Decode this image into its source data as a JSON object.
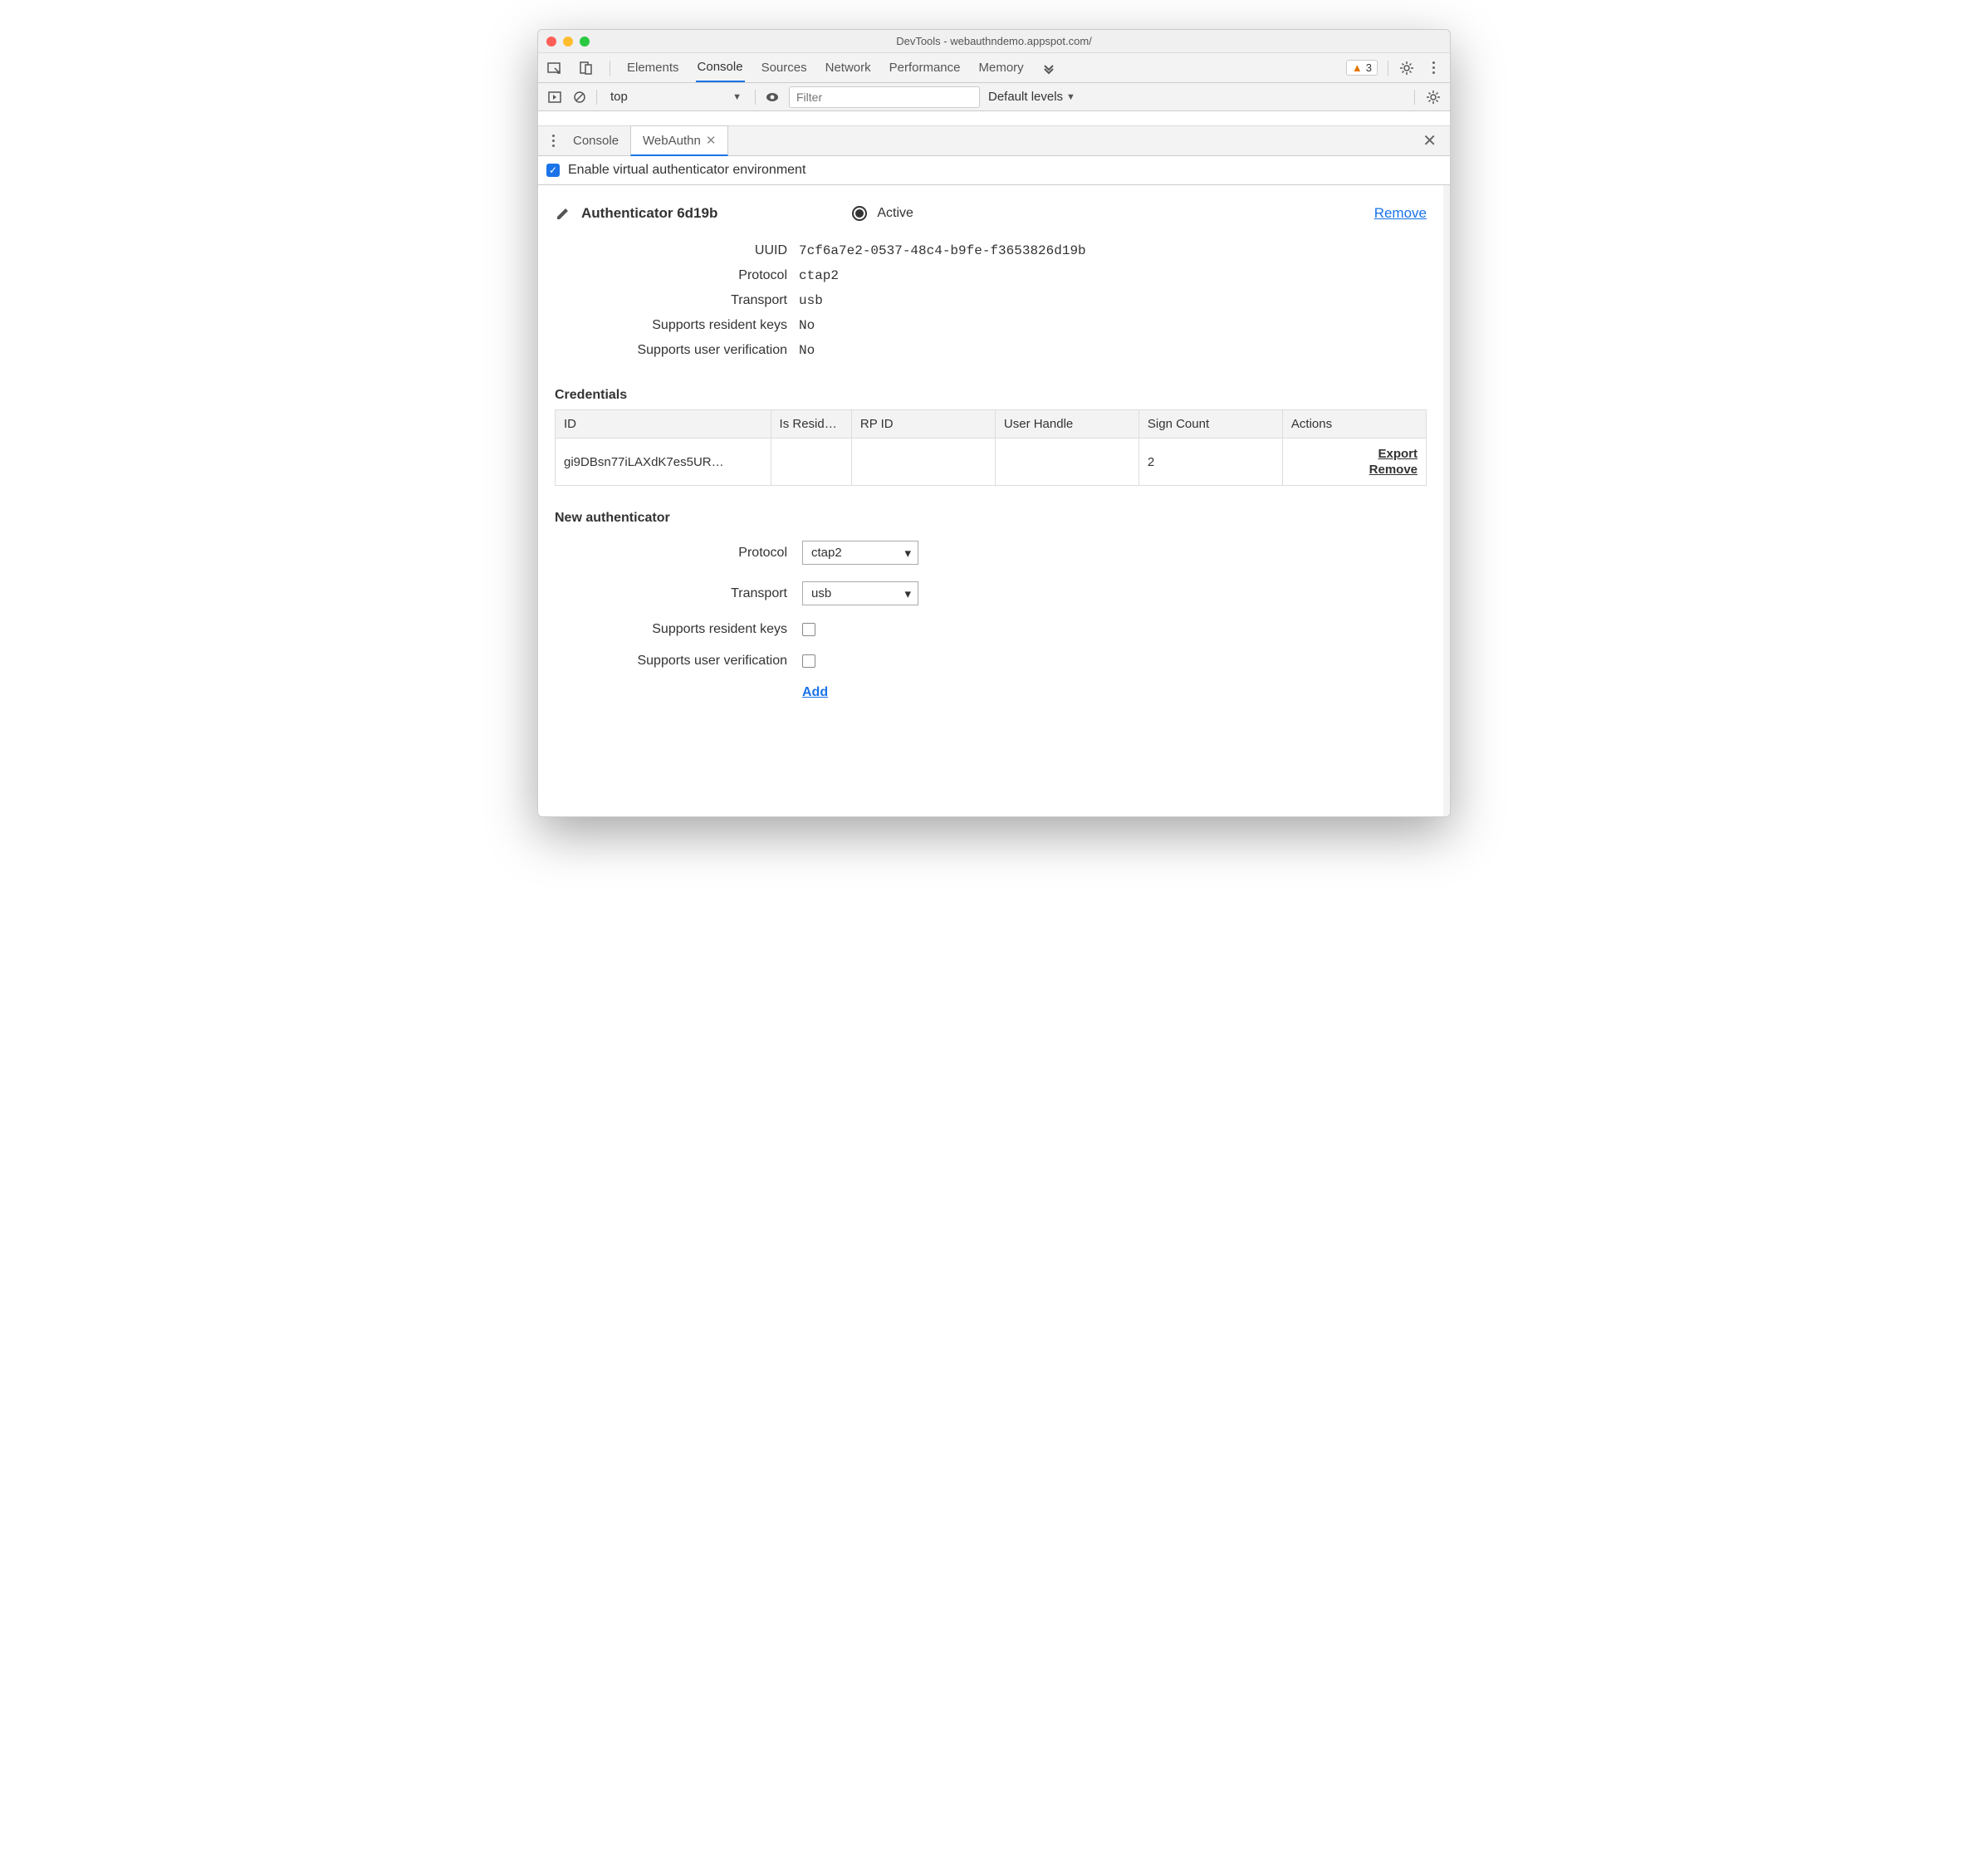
{
  "window": {
    "title": "DevTools - webauthndemo.appspot.com/"
  },
  "main_tabs": {
    "elements": "Elements",
    "console": "Console",
    "sources": "Sources",
    "network": "Network",
    "performance": "Performance",
    "memory": "Memory",
    "active": "Console"
  },
  "issues": {
    "count": "3"
  },
  "console_bar": {
    "context": "top",
    "filter_placeholder": "Filter",
    "levels": "Default levels"
  },
  "drawer_tabs": {
    "console": "Console",
    "webauthn": "WebAuthn",
    "active": "WebAuthn"
  },
  "enable_label": "Enable virtual authenticator environment",
  "authenticator": {
    "name": "Authenticator 6d19b",
    "active_label": "Active",
    "remove_label": "Remove",
    "props": {
      "uuid_label": "UUID",
      "uuid": "7cf6a7e2-0537-48c4-b9fe-f3653826d19b",
      "protocol_label": "Protocol",
      "protocol": "ctap2",
      "transport_label": "Transport",
      "transport": "usb",
      "rk_label": "Supports resident keys",
      "rk": "No",
      "uv_label": "Supports user verification",
      "uv": "No"
    }
  },
  "credentials": {
    "title": "Credentials",
    "headers": {
      "id": "ID",
      "is_resident": "Is Resid…",
      "rp_id": "RP ID",
      "user_handle": "User Handle",
      "sign_count": "Sign Count",
      "actions": "Actions"
    },
    "rows": [
      {
        "id": "gi9DBsn77iLAXdK7es5UR…",
        "is_resident": "",
        "rp_id": "",
        "user_handle": "",
        "sign_count": "2",
        "export": "Export",
        "remove": "Remove"
      }
    ]
  },
  "new_auth": {
    "title": "New authenticator",
    "protocol_label": "Protocol",
    "protocol_value": "ctap2",
    "transport_label": "Transport",
    "transport_value": "usb",
    "rk_label": "Supports resident keys",
    "uv_label": "Supports user verification",
    "add_label": "Add"
  }
}
